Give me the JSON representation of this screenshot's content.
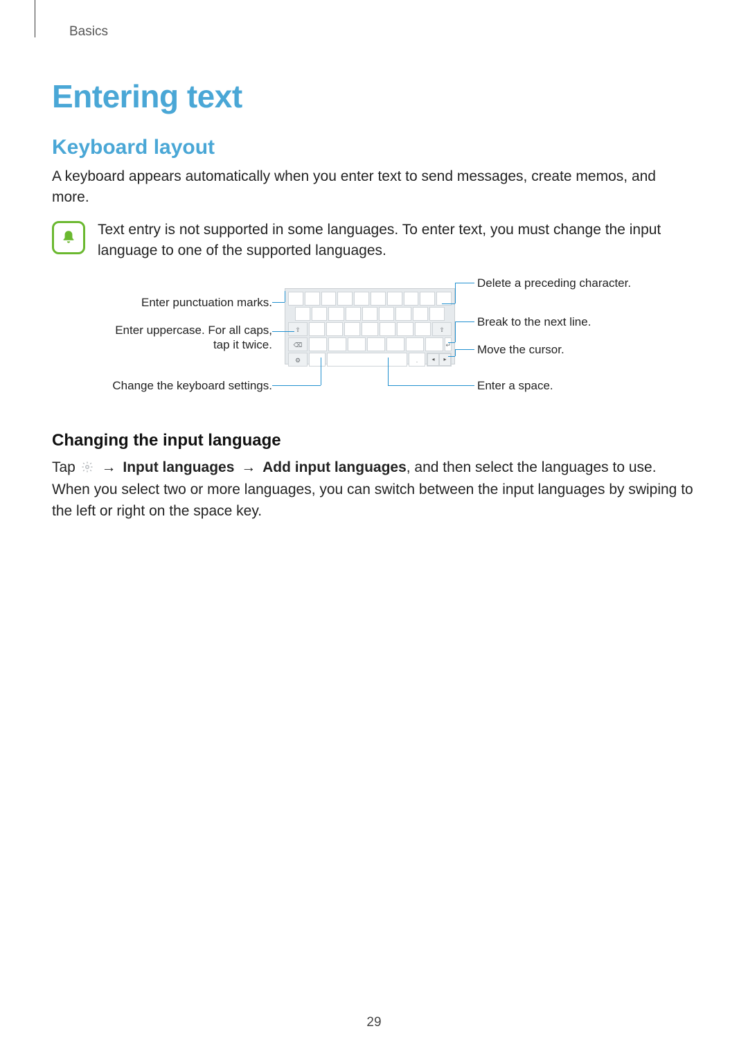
{
  "breadcrumb": "Basics",
  "heading": "Entering text",
  "section1_title": "Keyboard layout",
  "section1_body": "A keyboard appears automatically when you enter text to send messages, create memos, and more.",
  "note_text": "Text entry is not supported in some languages. To enter text, you must change the input language to one of the supported languages.",
  "callouts": {
    "left1": "Enter punctuation marks.",
    "left2_line1": "Enter uppercase. For all caps,",
    "left2_line2": "tap it twice.",
    "left3": "Change the keyboard settings.",
    "right1": "Delete a preceding character.",
    "right2": "Break to the next line.",
    "right3": "Move the cursor.",
    "right4": "Enter a space."
  },
  "section2_title": "Changing the input language",
  "para2_pre": "Tap ",
  "para2_bold1": "Input languages",
  "para2_bold2": "Add input languages",
  "para2_tail": ", and then select the languages to use. When you select two or more languages, you can switch between the input languages by swiping to the left or right on the space key.",
  "arrow": "→",
  "page_number": "29"
}
